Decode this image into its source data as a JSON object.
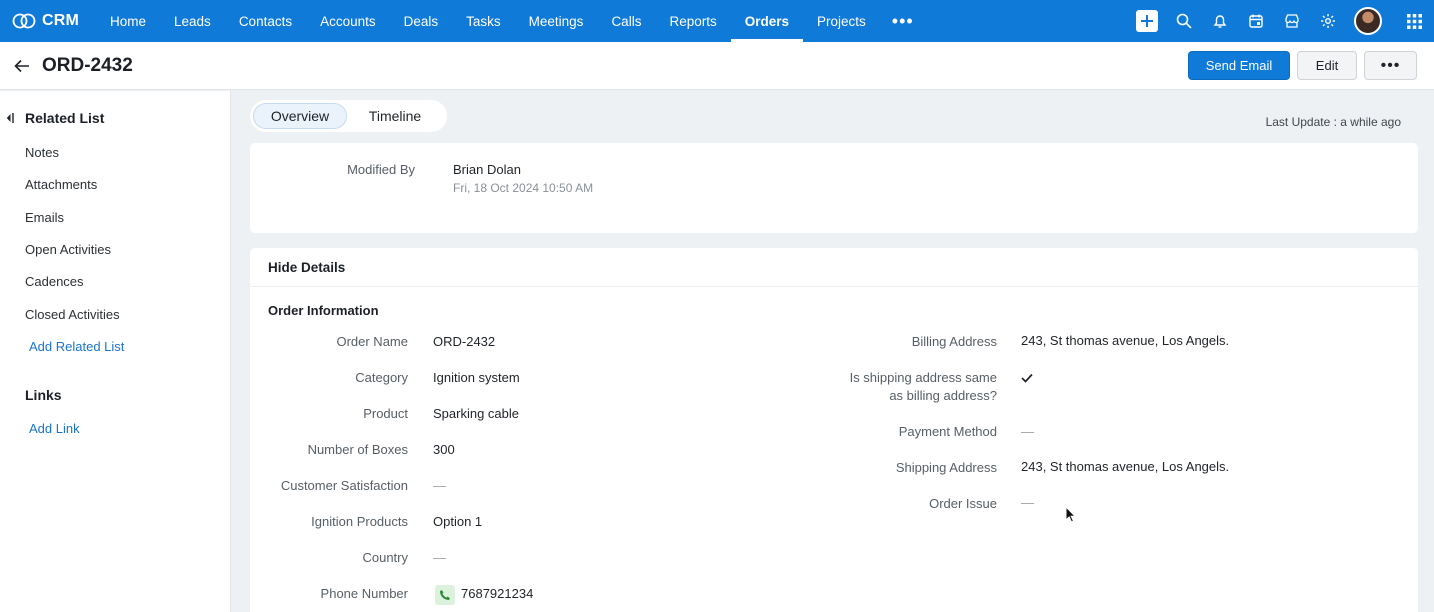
{
  "brand": {
    "name": "CRM"
  },
  "nav": {
    "tabs": [
      "Home",
      "Leads",
      "Contacts",
      "Accounts",
      "Deals",
      "Tasks",
      "Meetings",
      "Calls",
      "Reports",
      "Orders",
      "Projects"
    ],
    "active_tab": "Orders",
    "more_glyph": "•••"
  },
  "colors": {
    "nav_bg": "#0f7ad8",
    "primary": "#0f7ad8",
    "link": "#1a73d0",
    "phone_icon_bg": "#dcf2dd"
  },
  "record": {
    "title": "ORD-2432",
    "actions": {
      "send_email": "Send Email",
      "edit": "Edit",
      "more": "•••"
    }
  },
  "sidebar": {
    "related_title": "Related List",
    "items": [
      "Notes",
      "Attachments",
      "Emails",
      "Open Activities",
      "Cadences",
      "Closed Activities"
    ],
    "add_related": "Add Related List",
    "links_title": "Links",
    "add_link": "Add Link"
  },
  "view_tabs": {
    "overview": "Overview",
    "timeline": "Timeline"
  },
  "last_update": "Last Update : a while ago",
  "modified": {
    "label": "Modified By",
    "name": "Brian Dolan",
    "time": "Fri, 18 Oct 2024 10:50 AM"
  },
  "details": {
    "hide_label": "Hide Details",
    "section_title": "Order Information",
    "left_fields": [
      {
        "label": "Order Name",
        "value": "ORD-2432"
      },
      {
        "label": "Category",
        "value": "Ignition system"
      },
      {
        "label": "Product",
        "value": "Sparking cable"
      },
      {
        "label": "Number of Boxes",
        "value": "300"
      },
      {
        "label": "Customer Satisfaction",
        "value": "—"
      },
      {
        "label": "Ignition Products",
        "value": "Option 1"
      },
      {
        "label": "Country",
        "value": "—"
      },
      {
        "label": "Phone Number",
        "value": "7687921234"
      }
    ],
    "right_fields": [
      {
        "label": "Billing Address",
        "value": "243, St thomas avenue, Los Angels."
      },
      {
        "label_line1": "Is shipping address same",
        "label_line2": "as billing address?",
        "value": "checked"
      },
      {
        "label": "Payment Method",
        "value": "—"
      },
      {
        "label": "Shipping Address",
        "value": "243, St thomas avenue, Los Angels."
      },
      {
        "label": "Order Issue",
        "value": "—"
      }
    ]
  },
  "icons": [
    "crm-logo-icon",
    "plus-icon",
    "search-icon",
    "bell-icon",
    "calendar-icon",
    "store-icon",
    "gear-icon",
    "avatar",
    "apps-grid-icon",
    "back-arrow-icon",
    "collapse-icon",
    "check-icon",
    "phone-icon",
    "mouse-cursor-icon"
  ]
}
